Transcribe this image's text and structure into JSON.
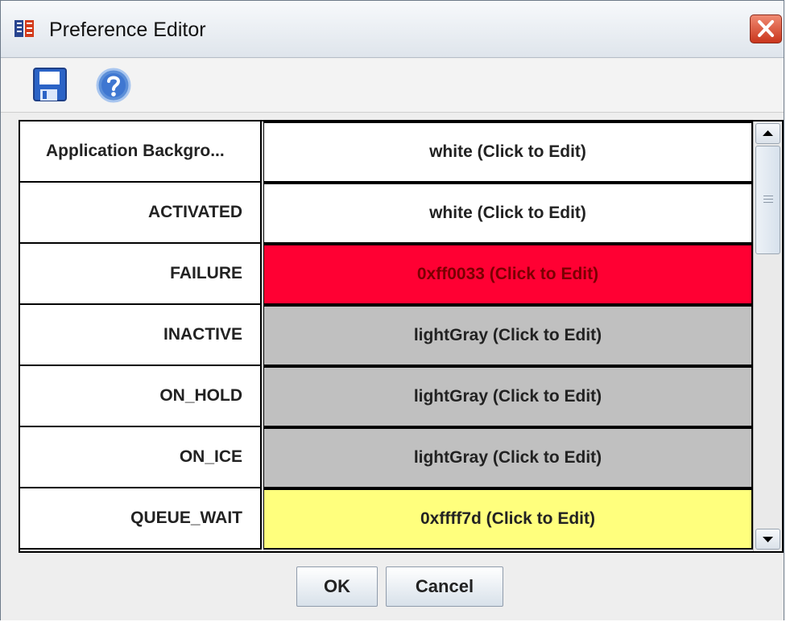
{
  "window": {
    "title": "Preference Editor"
  },
  "toolbar": {
    "save_icon": "save-icon",
    "help_icon": "help-icon"
  },
  "table": {
    "rows": [
      {
        "label": "Application Backgro...",
        "value": "white (Click to Edit)",
        "color": "#ffffff"
      },
      {
        "label": "ACTIVATED",
        "value": "white (Click to Edit)",
        "color": "#ffffff"
      },
      {
        "label": "FAILURE",
        "value": "0xff0033 (Click to Edit)",
        "color": "#ff0033"
      },
      {
        "label": "INACTIVE",
        "value": "lightGray (Click to Edit)",
        "color": "#c0c0c0"
      },
      {
        "label": "ON_HOLD",
        "value": "lightGray (Click to Edit)",
        "color": "#c0c0c0"
      },
      {
        "label": "ON_ICE",
        "value": "lightGray (Click to Edit)",
        "color": "#c0c0c0"
      },
      {
        "label": "QUEUE_WAIT",
        "value": "0xffff7d (Click to Edit)",
        "color": "#ffff7d"
      }
    ]
  },
  "footer": {
    "ok_label": "OK",
    "cancel_label": "Cancel"
  }
}
